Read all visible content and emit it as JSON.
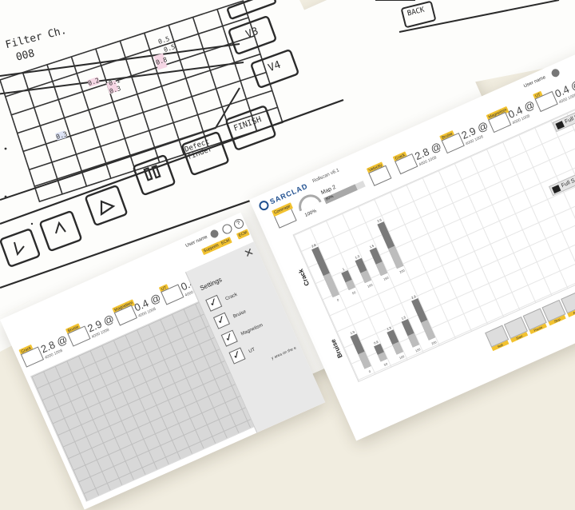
{
  "sketch_main": {
    "label_filter": "Filter Ch.",
    "label_code": "008",
    "cell_labels": [
      "0.5",
      "0.2",
      "0.1",
      "0.3",
      "0.8",
      "0.5",
      "0.3"
    ],
    "buttons": {
      "v3": "V3",
      "v4": "V4",
      "defect_finder": "Defect finder",
      "finish": "FINISH"
    }
  },
  "sketch_top": {
    "back": "BACK"
  },
  "app_main": {
    "logo": "SARCLAD",
    "version": "Rollscan v6.1",
    "user_name": "User name",
    "map_label": "Map 2",
    "map_percent": "80%",
    "gauge_percent": "100%",
    "metrics": [
      {
        "tab": "Crack",
        "value": "2.8 @",
        "sub": "4000 1008"
      },
      {
        "tab": "Bruise",
        "value": "2.9 @",
        "sub": "4000 1008"
      },
      {
        "tab": "Magnetism",
        "value": "0.4 @",
        "sub": "4000 1008"
      },
      {
        "tab": "UT",
        "value": "0.4 @",
        "sub": "4000 1008"
      }
    ],
    "extra_tabs": [
      "Coverage",
      "Velocity",
      "Crack"
    ],
    "full_screen": "Full Screen",
    "full_screen_2": "Full S",
    "charts": [
      {
        "label": "Crack",
        "x": [
          "0",
          "50",
          "100",
          "150",
          "200"
        ],
        "values": [
          2.8,
          1.0,
          1.3,
          1.5,
          2.6
        ],
        "labels": [
          "2.8",
          "1",
          "1.3",
          "1.5",
          "2.6"
        ]
      },
      {
        "label": "Bruise",
        "x": [
          "0",
          "50",
          "100",
          "150",
          "200"
        ],
        "values": [
          1.9,
          0.9,
          1.3,
          1.5,
          2.3
        ],
        "labels": [
          "1.9",
          "0.9",
          "1.3",
          "1.5",
          "2.3"
        ]
      }
    ],
    "bottom_tabs": [
      "Roll",
      "Start",
      "Pause",
      "Stop",
      "Area"
    ]
  },
  "app_left": {
    "user_name": "User name",
    "metrics": [
      {
        "tab": "Crack",
        "value": "2.8 @",
        "sub": "4000 1008"
      },
      {
        "tab": "Bruise",
        "value": "2.9 @",
        "sub": "4000 1008"
      },
      {
        "tab": "Magnetism",
        "value": "0.4 @",
        "sub": "4000 1008"
      },
      {
        "tab": "UT",
        "value": "0.4 @",
        "sub": "4000 1008"
      }
    ],
    "top_tabs": [
      "Supports",
      "ECM",
      "ECM"
    ],
    "settings": {
      "title": "Settings",
      "items": [
        {
          "label": "Crack",
          "checked": true
        },
        {
          "label": "Bruise",
          "checked": true
        },
        {
          "label": "Magnetism",
          "checked": true
        },
        {
          "label": "UT",
          "checked": true
        }
      ],
      "note": "y area on the e"
    }
  }
}
